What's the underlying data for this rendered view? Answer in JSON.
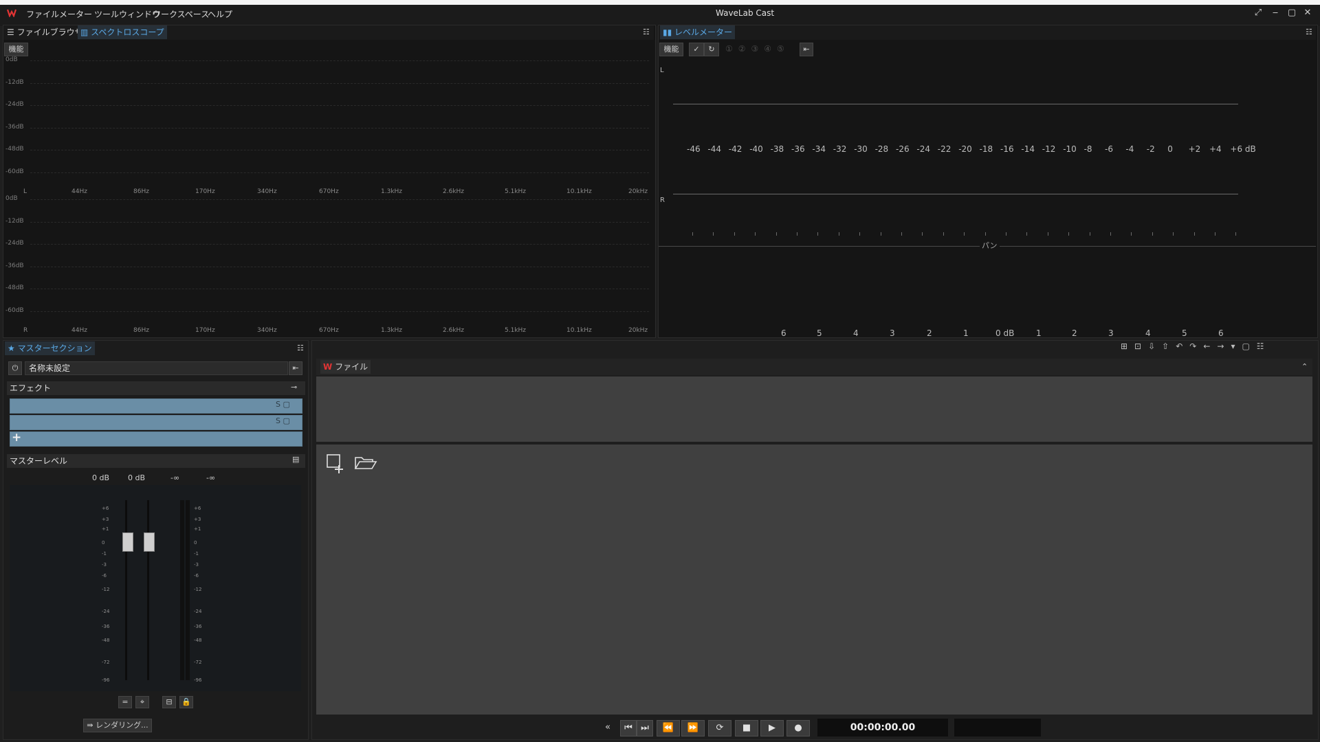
{
  "app": {
    "title": "WaveLab Cast"
  },
  "menu": [
    "ファイル",
    "メーター",
    "ツールウィンドウ",
    "ワークスペース",
    "ヘルプ"
  ],
  "spectroscope": {
    "tabs": [
      "ファイルブラウザー",
      "スペクトロスコープ"
    ],
    "func_label": "機能",
    "db_labels": [
      "0dB",
      "-12dB",
      "-24dB",
      "-36dB",
      "-48dB",
      "-60dB"
    ],
    "freq_labels": [
      "44Hz",
      "86Hz",
      "170Hz",
      "340Hz",
      "670Hz",
      "1.3kHz",
      "2.6kHz",
      "5.1kHz",
      "10.1kHz",
      "20kHz"
    ],
    "channel_l": "L",
    "channel_r": "R"
  },
  "level_meter": {
    "tab": "レベルメーター",
    "func_label": "機能",
    "channel_l": "L",
    "channel_r": "R",
    "scale": [
      "-46",
      "-44",
      "-42",
      "-40",
      "-38",
      "-36",
      "-34",
      "-32",
      "-30",
      "-28",
      "-26",
      "-24",
      "-22",
      "-20",
      "-18",
      "-16",
      "-14",
      "-12",
      "-10",
      "-8",
      "-6",
      "-4",
      "-2",
      "0",
      "+2",
      "+4",
      "+6 dB"
    ],
    "pan_label": "パン",
    "pan_scale": [
      "6",
      "5",
      "4",
      "3",
      "2",
      "1",
      "0 dB",
      "1",
      "2",
      "3",
      "4",
      "5",
      "6"
    ]
  },
  "master": {
    "tab": "マスターセクション",
    "preset_name": "名称未設定",
    "effects_label": "エフェクト",
    "master_level_label": "マスターレベル",
    "level_values": [
      "0 dB",
      "0 dB",
      "-∞",
      "-∞"
    ],
    "fader_scale": [
      "+6",
      "+3",
      "+1",
      "0",
      "-1",
      "-3",
      "-6",
      "-12",
      "-24",
      "-36",
      "-48",
      "-72",
      "-96"
    ],
    "render_label": "レンダリング..."
  },
  "file_area": {
    "tab": "ファイル"
  },
  "transport": {
    "time": "00:00:00.00"
  }
}
